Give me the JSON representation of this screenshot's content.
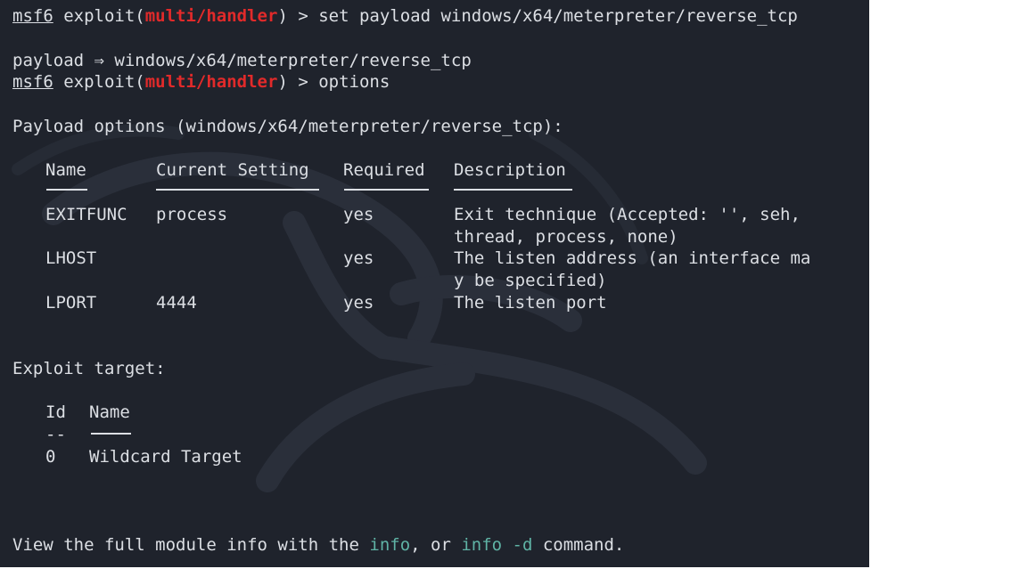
{
  "colors": {
    "background": "#1f232c",
    "text": "#dcdfe4",
    "module_highlight": "#e12a2a",
    "command_highlight": "#5fb3a5"
  },
  "prompt": {
    "prefix": "msf6",
    "middle": " exploit(",
    "module": "multi/handler",
    "suffix": ") > "
  },
  "lines": {
    "cmd1": "set payload windows/x64/meterpreter/reverse_tcp",
    "result1": "payload ⇒ windows/x64/meterpreter/reverse_tcp",
    "cmd2": "options",
    "payload_heading": "Payload options (windows/x64/meterpreter/reverse_tcp):"
  },
  "payload_table": {
    "headers": [
      "Name",
      "Current Setting",
      "Required",
      "Description"
    ],
    "rows": [
      {
        "name": "EXITFUNC",
        "setting": "process",
        "required": "yes",
        "desc1": "Exit technique (Accepted: '', seh,",
        "desc2": "thread, process, none)"
      },
      {
        "name": "LHOST",
        "setting": "",
        "required": "yes",
        "desc1": "The listen address (an interface ma",
        "desc2": "y be specified)"
      },
      {
        "name": "LPORT",
        "setting": "4444",
        "required": "yes",
        "desc1": "The listen port",
        "desc2": ""
      }
    ]
  },
  "exploit_target": {
    "heading": "Exploit target:",
    "headers": [
      "Id",
      "Name"
    ],
    "dash": "--",
    "rows": [
      {
        "id": "0",
        "name": "Wildcard Target"
      }
    ]
  },
  "footer": {
    "before": "View the full module info with the ",
    "cmd1": "info",
    "middle": ", or ",
    "cmd2": "info -d",
    "after": " command."
  }
}
